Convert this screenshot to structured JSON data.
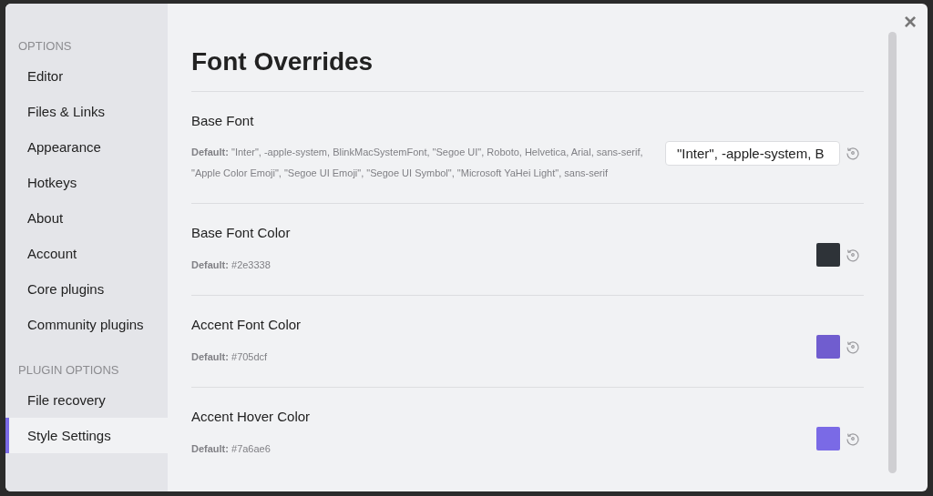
{
  "sidebar": {
    "sections": [
      {
        "heading": "OPTIONS",
        "items": [
          {
            "label": "Editor",
            "selected": false
          },
          {
            "label": "Files & Links",
            "selected": false
          },
          {
            "label": "Appearance",
            "selected": false
          },
          {
            "label": "Hotkeys",
            "selected": false
          },
          {
            "label": "About",
            "selected": false
          },
          {
            "label": "Account",
            "selected": false
          },
          {
            "label": "Core plugins",
            "selected": false
          },
          {
            "label": "Community plugins",
            "selected": false
          }
        ]
      },
      {
        "heading": "PLUGIN OPTIONS",
        "items": [
          {
            "label": "File recovery",
            "selected": false
          },
          {
            "label": "Style Settings",
            "selected": true
          }
        ]
      }
    ]
  },
  "close": "×",
  "title": "Font Overrides",
  "settings": [
    {
      "kind": "text",
      "name": "Base Font",
      "description": "**Default:** \"Inter\", -apple-system, BlinkMacSystemFont, \"Segoe UI\", Roboto, Helvetica, Arial, sans-serif, \"Apple Color Emoji\", \"Segoe UI Emoji\", \"Segoe UI Symbol\", \"Microsoft YaHei Light\", sans-serif",
      "value": "\"Inter\", -apple-system, B"
    },
    {
      "kind": "color",
      "name": "Base Font Color",
      "description": "**Default:** #2e3338",
      "color": "#2e3338"
    },
    {
      "kind": "color",
      "name": "Accent Font Color",
      "description": "**Default:** #705dcf",
      "color": "#705dcf"
    },
    {
      "kind": "color",
      "name": "Accent Hover Color",
      "description": "**Default:** #7a6ae6",
      "color": "#7a6ae6"
    }
  ]
}
